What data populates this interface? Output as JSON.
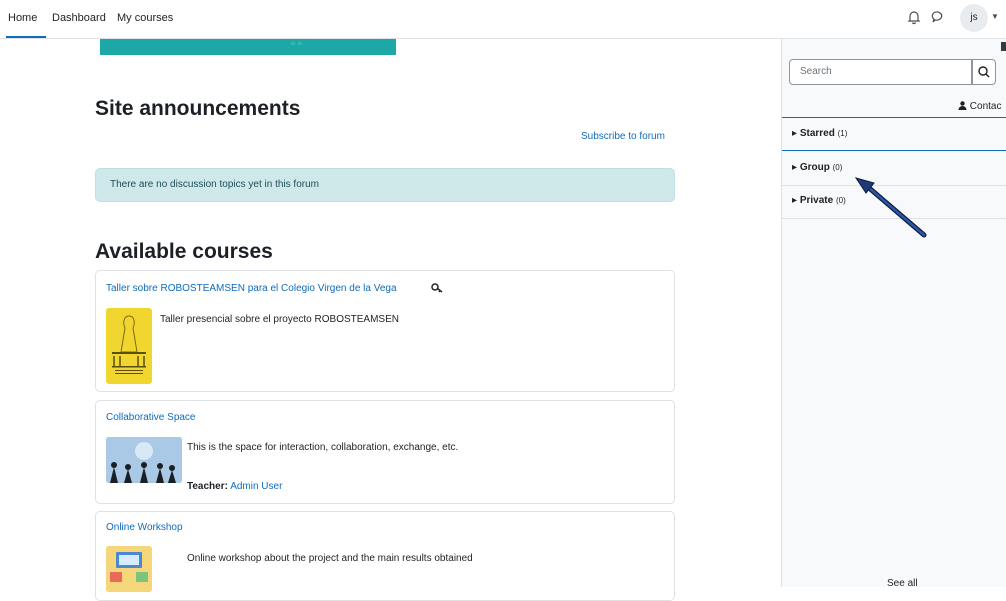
{
  "nav": {
    "home": "Home",
    "dashboard": "Dashboard",
    "my_courses": "My courses",
    "avatar_initials": "js"
  },
  "main": {
    "site_announcements_title": "Site announcements",
    "subscribe_link": "Subscribe to forum",
    "no_topics_alert": "There are no discussion topics yet in this forum",
    "available_courses_title": "Available courses",
    "courses": [
      {
        "name": "Taller sobre ROBOSTEAMSEN para el Colegio Virgen de la Vega",
        "summary": "Taller presencial sobre el proyecto ROBOSTEAMSEN",
        "enrol_icon": "key-icon"
      },
      {
        "name": "Collaborative Space",
        "summary": "This is the space for interaction, collaboration, exchange, etc.",
        "teacher_label": "Teacher:",
        "teacher_name": "Admin User"
      },
      {
        "name": "Online Workshop",
        "summary": "Online workshop about the project and the main results obtained"
      }
    ]
  },
  "drawer": {
    "search_placeholder": "Search",
    "contacts_label": "Contac",
    "groups": [
      {
        "label": "Starred",
        "count": "(1)"
      },
      {
        "label": "Group",
        "count": "(0)"
      },
      {
        "label": "Private",
        "count": "(0)"
      }
    ],
    "see_all": "See all"
  },
  "colors": {
    "accent": "#0f6cbf",
    "alert_bg": "#cfe8ea",
    "banner": "#1ba8a6",
    "annotation_arrow": "#1f3a7a"
  },
  "icons": [
    "bell-icon",
    "chat-icon",
    "search-icon",
    "user-icon",
    "key-icon",
    "caret-right-icon",
    "chevron-down-icon"
  ]
}
